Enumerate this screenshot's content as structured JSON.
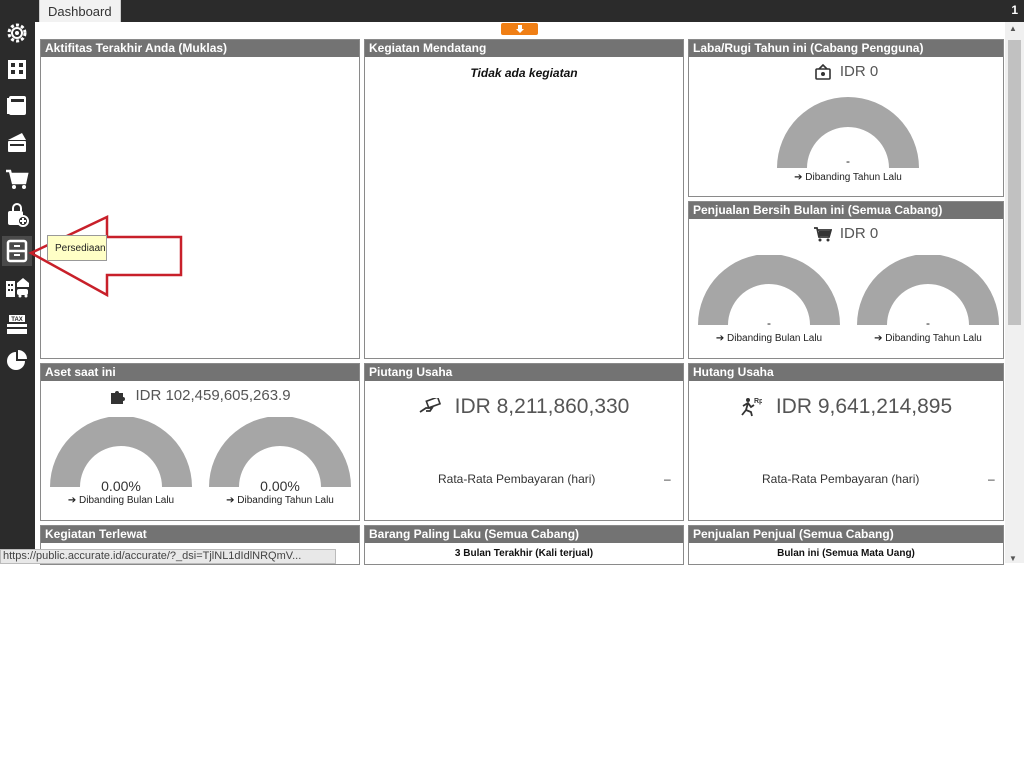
{
  "tab": {
    "label": "Dashboard"
  },
  "top_right_badge": "1",
  "sidebar": {
    "items": [
      {
        "icon": "settings-gear-icon"
      },
      {
        "icon": "company-building-icon"
      },
      {
        "icon": "ledger-book-icon"
      },
      {
        "icon": "cash-bank-icon"
      },
      {
        "icon": "sales-cart-icon"
      },
      {
        "icon": "purchase-bag-icon"
      },
      {
        "icon": "inventory-cabinet-icon",
        "active": true
      },
      {
        "icon": "fixed-assets-icon"
      },
      {
        "icon": "tax-icon"
      },
      {
        "icon": "reports-pie-icon"
      }
    ]
  },
  "tooltip": {
    "text": "Persediaan"
  },
  "panels": {
    "activity": {
      "title": "Aktifitas Terakhir Anda (Muklas)"
    },
    "upcoming": {
      "title": "Kegiatan Mendatang",
      "empty_text": "Tidak ada kegiatan"
    },
    "profit_loss": {
      "title": "Laba/Rugi Tahun ini (Cabang Pengguna)",
      "amount": "IDR 0",
      "gauge_value": "-",
      "caption": "Dibanding Tahun Lalu"
    },
    "net_sales": {
      "title": "Penjualan Bersih Bulan ini (Semua Cabang)",
      "amount": "IDR 0",
      "gauge_left": {
        "value": "-",
        "caption": "Dibanding Bulan Lalu"
      },
      "gauge_right": {
        "value": "-",
        "caption": "Dibanding Tahun Lalu"
      }
    },
    "assets": {
      "title": "Aset saat ini",
      "amount": "IDR 102,459,605,263.9",
      "gauge_left": {
        "value": "0.00%",
        "caption": "Dibanding Bulan Lalu"
      },
      "gauge_right": {
        "value": "0.00%",
        "caption": "Dibanding Tahun Lalu"
      }
    },
    "receivables": {
      "title": "Piutang Usaha",
      "amount": "IDR 8,211,860,330",
      "rate_label": "Rata-Rata Pembayaran (hari)",
      "rate_value": "–"
    },
    "payables": {
      "title": "Hutang Usaha",
      "amount": "IDR 9,641,214,895",
      "rate_label": "Rata-Rata Pembayaran (hari)",
      "rate_value": "–"
    },
    "overdue": {
      "title": "Kegiatan Terlewat"
    },
    "best_sellers": {
      "title": "Barang Paling Laku (Semua Cabang)",
      "subtitle": "3 Bulan Terakhir (Kali terjual)"
    },
    "salesperson": {
      "title": "Penjualan Penjual (Semua Cabang)",
      "subtitle": "Bulan ini (Semua Mata Uang)"
    }
  },
  "status_url": "https://public.accurate.id/accurate/?_dsi=TjlNL1dIdlNRQmV...",
  "colors": {
    "sidebar": "#2b2b2b",
    "panel_header": "#737373",
    "gauge": "#a6a6a6",
    "accent": "#f07f15",
    "arrow": "#c8202a"
  }
}
